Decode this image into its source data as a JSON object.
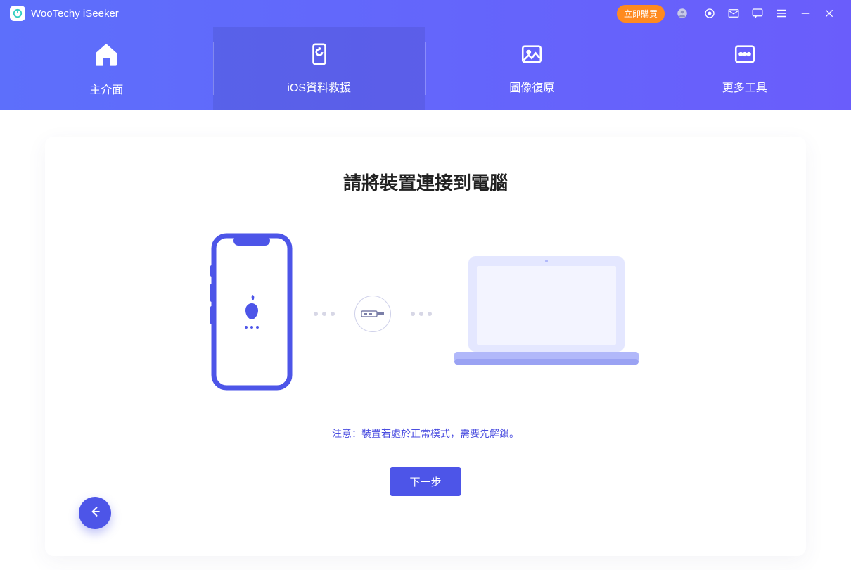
{
  "app": {
    "title": "WooTechy iSeeker"
  },
  "titlebar": {
    "buy_label": "立即購買"
  },
  "nav": [
    {
      "label": "主介面"
    },
    {
      "label": "iOS資料救援"
    },
    {
      "label": "圖像復原"
    },
    {
      "label": "更多工具"
    }
  ],
  "page": {
    "heading": "請將裝置連接到電腦",
    "notice": "注意：裝置若處於正常模式，需要先解鎖。",
    "next_label": "下一步"
  },
  "colors": {
    "accent": "#4d55e8",
    "illustration_light": "#e4e7ff",
    "illustration_mid": "#b1b8fa"
  }
}
